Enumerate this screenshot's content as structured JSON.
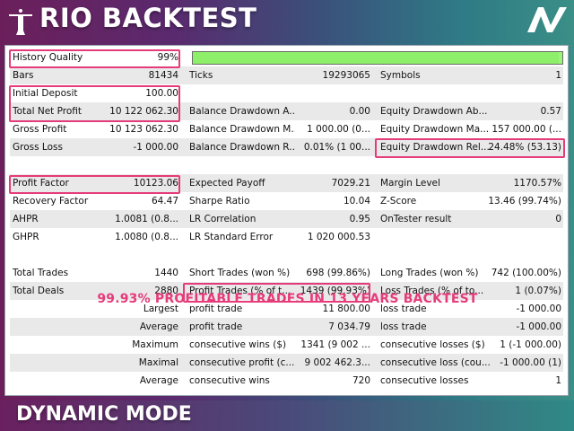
{
  "header": {
    "title": "RIO BACKTEST"
  },
  "footer": {
    "mode_label": "DYNAMIC MODE"
  },
  "report": {
    "history_quality": {
      "label": "History Quality",
      "value": "99%",
      "fill": 0.99
    },
    "rows": [
      {
        "l1": "Bars",
        "v1": "81434",
        "l2": "Ticks",
        "v2": "19293065",
        "l3": "Symbols",
        "v3": "1"
      },
      {
        "l1": "Initial Deposit",
        "v1": "100.00",
        "l2": "",
        "v2": "",
        "l3": "",
        "v3": ""
      },
      {
        "l1": "Total Net Profit",
        "v1": "10 122 062.30",
        "l2": "Balance Drawdown A...",
        "v2": "0.00",
        "l3": "Equity Drawdown Ab...",
        "v3": "0.57"
      },
      {
        "l1": "Gross Profit",
        "v1": "10 123 062.30",
        "l2": "Balance Drawdown M...",
        "v2": "1 000.00 (0...",
        "l3": "Equity Drawdown Ma...",
        "v3": "157 000.00 (..."
      },
      {
        "l1": "Gross Loss",
        "v1": "-1 000.00",
        "l2": "Balance Drawdown R...",
        "v2": "0.01% (1 00...",
        "l3": "Equity Drawdown Rel...",
        "v3": "24.48% (53.13)"
      },
      {
        "l1": "",
        "v1": "",
        "l2": "",
        "v2": "",
        "l3": "",
        "v3": ""
      },
      {
        "l1": "Profit Factor",
        "v1": "10123.06",
        "l2": "Expected Payoff",
        "v2": "7029.21",
        "l3": "Margin Level",
        "v3": "1170.57%"
      },
      {
        "l1": "Recovery Factor",
        "v1": "64.47",
        "l2": "Sharpe Ratio",
        "v2": "10.04",
        "l3": "Z-Score",
        "v3": "13.46 (99.74%)"
      },
      {
        "l1": "AHPR",
        "v1": "1.0081 (0.8...",
        "l2": "LR Correlation",
        "v2": "0.95",
        "l3": "OnTester result",
        "v3": "0"
      },
      {
        "l1": "GHPR",
        "v1": "1.0080 (0.8...",
        "l2": "LR Standard Error",
        "v2": "1 020 000.53",
        "l3": "",
        "v3": ""
      }
    ],
    "banner": "99.93% PROFITABLE TRADES IN 13 YEARS BACKTEST",
    "trade_rows": [
      {
        "l1": "Total Trades",
        "v1": "1440",
        "l2": "Short Trades (won %)",
        "v2": "698 (99.86%)",
        "l3": "Long Trades (won %)",
        "v3": "742 (100.00%)"
      },
      {
        "l1": "Total Deals",
        "v1": "2880",
        "l2": "Profit Trades (% of t...",
        "v2": "1439 (99.93%)",
        "l3": "Loss Trades (% of to...",
        "v3": "1 (0.07%)"
      },
      {
        "r1": "Largest",
        "l2": "profit trade",
        "v2": "11 800.00",
        "l3": "loss trade",
        "v3": "-1 000.00"
      },
      {
        "r1": "Average",
        "l2": "profit trade",
        "v2": "7 034.79",
        "l3": "loss trade",
        "v3": "-1 000.00"
      },
      {
        "r1": "Maximum",
        "l2": "consecutive wins ($)",
        "v2": "1341 (9 002 ...",
        "l3": "consecutive losses ($)",
        "v3": "1 (-1 000.00)"
      },
      {
        "r1": "Maximal",
        "l2": "consecutive profit (c...",
        "v2": "9 002 462.3...",
        "l3": "consecutive loss (cou...",
        "v3": "-1 000.00 (1)"
      },
      {
        "r1": "Average",
        "l2": "consecutive wins",
        "v2": "720",
        "l3": "consecutive losses",
        "v3": "1"
      }
    ]
  },
  "colors": {
    "highlight": "#e63b7a",
    "quality_bar": "#8ef06a",
    "row_alt": "#e9e9e9"
  },
  "icons": {
    "logo": "christ-redeemer-figure-icon",
    "brand": "av-brand-icon"
  }
}
